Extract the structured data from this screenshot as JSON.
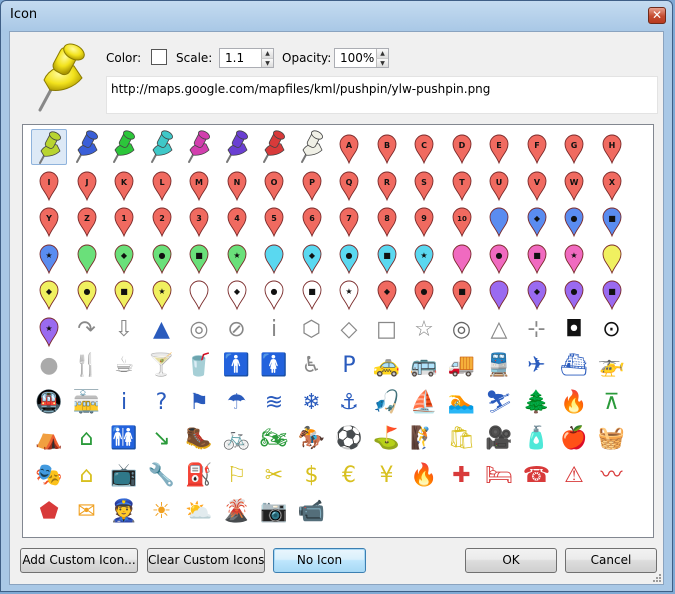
{
  "window": {
    "title": "Icon",
    "close_glyph": "✕"
  },
  "controls": {
    "color_label": "Color:",
    "scale_label": "Scale:",
    "scale_value": "1.1",
    "opacity_label": "Opacity:",
    "opacity_value": "100%",
    "url": "http://maps.google.com/mapfiles/kml/pushpin/ylw-pushpin.png"
  },
  "pushpins": [
    {
      "name": "ylw-pushpin",
      "color": "#b8d430"
    },
    {
      "name": "blue-pushpin",
      "color": "#3a5fd8"
    },
    {
      "name": "grn-pushpin",
      "color": "#2cc63a"
    },
    {
      "name": "ltblu-pushpin",
      "color": "#3fc8c8"
    },
    {
      "name": "pink-pushpin",
      "color": "#d23fae"
    },
    {
      "name": "purple-pushpin",
      "color": "#6a3fd2"
    },
    {
      "name": "red-pushpin",
      "color": "#d83a3a"
    },
    {
      "name": "wht-pushpin",
      "color": "#f0f0e6"
    }
  ],
  "paddles": [
    {
      "label": "A",
      "fill": "#f06a60"
    },
    {
      "label": "B",
      "fill": "#f06a60"
    },
    {
      "label": "C",
      "fill": "#f06a60"
    },
    {
      "label": "D",
      "fill": "#f06a60"
    },
    {
      "label": "E",
      "fill": "#f06a60"
    },
    {
      "label": "F",
      "fill": "#f06a60"
    },
    {
      "label": "G",
      "fill": "#f06a60"
    },
    {
      "label": "H",
      "fill": "#f06a60"
    },
    {
      "label": "I",
      "fill": "#f06a60"
    },
    {
      "label": "J",
      "fill": "#f06a60"
    },
    {
      "label": "K",
      "fill": "#f06a60"
    },
    {
      "label": "L",
      "fill": "#f06a60"
    },
    {
      "label": "M",
      "fill": "#f06a60"
    },
    {
      "label": "N",
      "fill": "#f06a60"
    },
    {
      "label": "O",
      "fill": "#f06a60"
    },
    {
      "label": "P",
      "fill": "#f06a60"
    },
    {
      "label": "Q",
      "fill": "#f06a60"
    },
    {
      "label": "R",
      "fill": "#f06a60"
    },
    {
      "label": "S",
      "fill": "#f06a60"
    },
    {
      "label": "T",
      "fill": "#f06a60"
    },
    {
      "label": "U",
      "fill": "#f06a60"
    },
    {
      "label": "V",
      "fill": "#f06a60"
    },
    {
      "label": "W",
      "fill": "#f06a60"
    },
    {
      "label": "X",
      "fill": "#f06a60"
    },
    {
      "label": "Y",
      "fill": "#f06a60"
    },
    {
      "label": "Z",
      "fill": "#f06a60"
    },
    {
      "label": "1",
      "fill": "#f06a60"
    },
    {
      "label": "2",
      "fill": "#f06a60"
    },
    {
      "label": "3",
      "fill": "#f06a60"
    },
    {
      "label": "4",
      "fill": "#f06a60"
    },
    {
      "label": "5",
      "fill": "#f06a60"
    },
    {
      "label": "6",
      "fill": "#f06a60"
    },
    {
      "label": "7",
      "fill": "#f06a60"
    },
    {
      "label": "8",
      "fill": "#f06a60"
    },
    {
      "label": "9",
      "fill": "#f06a60"
    },
    {
      "label": "10",
      "fill": "#f06a60"
    },
    {
      "label": "",
      "fill": "#5a8cf0"
    },
    {
      "label": "◆",
      "fill": "#5a8cf0"
    },
    {
      "label": "●",
      "fill": "#5a8cf0"
    },
    {
      "label": "■",
      "fill": "#5a8cf0"
    },
    {
      "label": "★",
      "fill": "#5a8cf0"
    },
    {
      "label": "",
      "fill": "#6ae07a"
    },
    {
      "label": "◆",
      "fill": "#6ae07a"
    },
    {
      "label": "●",
      "fill": "#6ae07a"
    },
    {
      "label": "■",
      "fill": "#6ae07a"
    },
    {
      "label": "★",
      "fill": "#6ae07a"
    },
    {
      "label": "",
      "fill": "#5ad8f0"
    },
    {
      "label": "◆",
      "fill": "#5ad8f0"
    },
    {
      "label": "●",
      "fill": "#5ad8f0"
    },
    {
      "label": "■",
      "fill": "#5ad8f0"
    },
    {
      "label": "★",
      "fill": "#5ad8f0"
    },
    {
      "label": "",
      "fill": "#f06ac0"
    },
    {
      "label": "●",
      "fill": "#f06ac0"
    },
    {
      "label": "■",
      "fill": "#f06ac0"
    },
    {
      "label": "★",
      "fill": "#f06ac0"
    },
    {
      "label": "",
      "fill": "#f0f060"
    },
    {
      "label": "◆",
      "fill": "#f0f060"
    },
    {
      "label": "●",
      "fill": "#f0f060"
    },
    {
      "label": "■",
      "fill": "#f0f060"
    },
    {
      "label": "★",
      "fill": "#f0f060"
    },
    {
      "label": "",
      "fill": "#ffffff"
    },
    {
      "label": "◆",
      "fill": "#ffffff"
    },
    {
      "label": "●",
      "fill": "#ffffff"
    },
    {
      "label": "■",
      "fill": "#ffffff"
    },
    {
      "label": "★",
      "fill": "#ffffff"
    },
    {
      "label": "◆",
      "fill": "#f06a60"
    },
    {
      "label": "●",
      "fill": "#f06a60"
    },
    {
      "label": "■",
      "fill": "#f06a60"
    },
    {
      "label": "",
      "fill": "#9a6af0"
    },
    {
      "label": "◆",
      "fill": "#9a6af0"
    },
    {
      "label": "●",
      "fill": "#9a6af0"
    },
    {
      "label": "■",
      "fill": "#9a6af0"
    },
    {
      "label": "★",
      "fill": "#9a6af0"
    }
  ],
  "shape_icons": [
    {
      "name": "arrow-reverse",
      "glyph": "↷",
      "color": "#888888"
    },
    {
      "name": "arrow",
      "glyph": "⇩",
      "color": "#888888"
    },
    {
      "name": "track",
      "glyph": "▲",
      "color": "#2a5bbd"
    },
    {
      "name": "donut",
      "glyph": "◎",
      "color": "#888888"
    },
    {
      "name": "forbidden",
      "glyph": "⊘",
      "color": "#888888"
    },
    {
      "name": "info-i",
      "glyph": "i",
      "color": "#888888"
    },
    {
      "name": "polygon",
      "glyph": "⬡",
      "color": "#888888"
    },
    {
      "name": "open-diamond",
      "glyph": "◇",
      "color": "#888888"
    },
    {
      "name": "square",
      "glyph": "□",
      "color": "#888888"
    },
    {
      "name": "star",
      "glyph": "☆",
      "color": "#888888"
    },
    {
      "name": "target",
      "glyph": "◎",
      "color": "#666666"
    },
    {
      "name": "triangle",
      "glyph": "△",
      "color": "#888888"
    },
    {
      "name": "cross-hairs",
      "glyph": "⊹",
      "color": "#888888"
    },
    {
      "name": "placemark-square",
      "glyph": "◘",
      "color": "#111111"
    },
    {
      "name": "placemark-circle",
      "glyph": "⊙",
      "color": "#111111"
    },
    {
      "name": "shaded-dot",
      "glyph": "●",
      "color": "#aaaaaa"
    },
    {
      "name": "dining",
      "glyph": "🍴",
      "color": "#888888"
    },
    {
      "name": "coffee",
      "glyph": "☕",
      "color": "#888888"
    },
    {
      "name": "bars",
      "glyph": "🍸",
      "color": "#888888"
    },
    {
      "name": "snack-bar",
      "glyph": "🥤",
      "color": "#888888"
    },
    {
      "name": "man",
      "glyph": "🚹",
      "color": "#888888"
    },
    {
      "name": "woman",
      "glyph": "🚺",
      "color": "#888888"
    },
    {
      "name": "wheel-chair",
      "glyph": "♿",
      "color": "#888888"
    },
    {
      "name": "parking",
      "glyph": "P",
      "color": "#2a5bbd"
    },
    {
      "name": "cabs",
      "glyph": "🚕",
      "color": "#2a5bbd"
    },
    {
      "name": "bus",
      "glyph": "🚌",
      "color": "#2a5bbd"
    },
    {
      "name": "truck",
      "glyph": "🚚",
      "color": "#2a5bbd"
    },
    {
      "name": "rail",
      "glyph": "🚆",
      "color": "#2a5bbd"
    },
    {
      "name": "airports",
      "glyph": "✈",
      "color": "#2a5bbd"
    },
    {
      "name": "ferry",
      "glyph": "⛴",
      "color": "#2a5bbd"
    },
    {
      "name": "heliport",
      "glyph": "🚁",
      "color": "#2a5bbd"
    },
    {
      "name": "subway",
      "glyph": "🚇",
      "color": "#2a5bbd"
    },
    {
      "name": "tram",
      "glyph": "🚋",
      "color": "#2a5bbd"
    },
    {
      "name": "info",
      "glyph": "i",
      "color": "#2a5bbd"
    },
    {
      "name": "info-circle",
      "glyph": "?",
      "color": "#2a5bbd"
    },
    {
      "name": "flag",
      "glyph": "⚑",
      "color": "#2a5bbd"
    },
    {
      "name": "rainy",
      "glyph": "☂",
      "color": "#2a5bbd"
    },
    {
      "name": "water",
      "glyph": "≋",
      "color": "#2a5bbd"
    },
    {
      "name": "snowflake",
      "glyph": "❄",
      "color": "#2a5bbd"
    },
    {
      "name": "marina",
      "glyph": "⚓",
      "color": "#2a5bbd"
    },
    {
      "name": "fishing",
      "glyph": "🎣",
      "color": "#2a5bbd"
    },
    {
      "name": "sailing",
      "glyph": "⛵",
      "color": "#2a5bbd"
    },
    {
      "name": "swimming",
      "glyph": "🏊",
      "color": "#2a5bbd"
    },
    {
      "name": "ski",
      "glyph": "⛷",
      "color": "#2a5bbd"
    },
    {
      "name": "parks",
      "glyph": "🌲",
      "color": "#2a9a3a"
    },
    {
      "name": "campfire",
      "glyph": "🔥",
      "color": "#2a9a3a"
    },
    {
      "name": "picnic",
      "glyph": "⊼",
      "color": "#2a9a3a"
    },
    {
      "name": "campground",
      "glyph": "⛺",
      "color": "#2a9a3a"
    },
    {
      "name": "ranger-station",
      "glyph": "⌂",
      "color": "#2a9a3a"
    },
    {
      "name": "toilets",
      "glyph": "🚻",
      "color": "#2a9a3a"
    },
    {
      "name": "poi",
      "glyph": "↘",
      "color": "#2a9a3a"
    },
    {
      "name": "hiker",
      "glyph": "🥾",
      "color": "#2a9a3a"
    },
    {
      "name": "cycling",
      "glyph": "🚲",
      "color": "#2a9a3a"
    },
    {
      "name": "motorcycling",
      "glyph": "🏍",
      "color": "#2a9a3a"
    },
    {
      "name": "horsebackriding",
      "glyph": "🏇",
      "color": "#2a9a3a"
    },
    {
      "name": "play",
      "glyph": "⚽",
      "color": "#2a9a3a"
    },
    {
      "name": "golf",
      "glyph": "⛳",
      "color": "#2a9a3a"
    },
    {
      "name": "trail",
      "glyph": "🧗",
      "color": "#2a9a3a"
    },
    {
      "name": "shopping",
      "glyph": "🛍",
      "color": "#d8c020"
    },
    {
      "name": "movies",
      "glyph": "🎥",
      "color": "#d8c020"
    },
    {
      "name": "convenience",
      "glyph": "🧴",
      "color": "#d8c020"
    },
    {
      "name": "grocery",
      "glyph": "🍎",
      "color": "#d8c020"
    },
    {
      "name": "basket",
      "glyph": "🧺",
      "color": "#d8c020"
    },
    {
      "name": "arts",
      "glyph": "🎭",
      "color": "#d8c020"
    },
    {
      "name": "homegardenbusiness",
      "glyph": "⌂",
      "color": "#d8c020"
    },
    {
      "name": "electronics",
      "glyph": "📺",
      "color": "#d8c020"
    },
    {
      "name": "mechanic",
      "glyph": "🔧",
      "color": "#d8c020"
    },
    {
      "name": "gas-stations",
      "glyph": "⛽",
      "color": "#d8c020"
    },
    {
      "name": "realestate",
      "glyph": "⚐",
      "color": "#d8c020"
    },
    {
      "name": "salon",
      "glyph": "✂",
      "color": "#d8c020"
    },
    {
      "name": "dollar",
      "glyph": "$",
      "color": "#d8c020"
    },
    {
      "name": "euro",
      "glyph": "€",
      "color": "#d8c020"
    },
    {
      "name": "yen",
      "glyph": "¥",
      "color": "#d8c020"
    },
    {
      "name": "firedept",
      "glyph": "🔥",
      "color": "#d83a3a"
    },
    {
      "name": "hospitals",
      "glyph": "✚",
      "color": "#d83a3a"
    },
    {
      "name": "lodging",
      "glyph": "🛏",
      "color": "#d83a3a"
    },
    {
      "name": "phone",
      "glyph": "☎",
      "color": "#d83a3a"
    },
    {
      "name": "caution",
      "glyph": "⚠",
      "color": "#d83a3a"
    },
    {
      "name": "earthquake",
      "glyph": "〰",
      "color": "#d83a3a"
    },
    {
      "name": "falling-rocks",
      "glyph": "⬟",
      "color": "#d83a3a"
    },
    {
      "name": "post-office",
      "glyph": "✉",
      "color": "#f0a020"
    },
    {
      "name": "police",
      "glyph": "👮",
      "color": "#f0a020"
    },
    {
      "name": "sunny",
      "glyph": "☀",
      "color": "#f0a020"
    },
    {
      "name": "partly-cloudy",
      "glyph": "⛅",
      "color": "#f0a020"
    },
    {
      "name": "volcano",
      "glyph": "🌋",
      "color": "#f0a020"
    },
    {
      "name": "camera",
      "glyph": "📷",
      "color": "#a040c0"
    },
    {
      "name": "webcam",
      "glyph": "📹",
      "color": "#a040c0"
    }
  ],
  "buttons": {
    "add_custom": "Add Custom Icon...",
    "clear_custom": "Clear Custom Icons",
    "no_icon": "No Icon",
    "ok": "OK",
    "cancel": "Cancel"
  }
}
